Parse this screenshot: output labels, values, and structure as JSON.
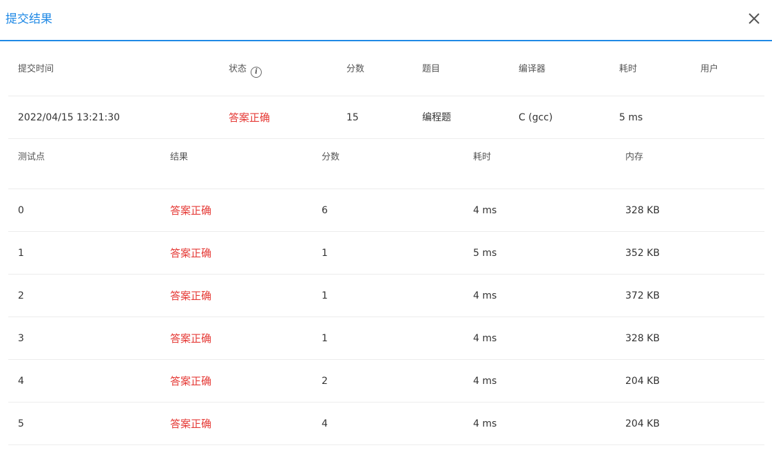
{
  "dialog": {
    "title": "提交结果"
  },
  "summary": {
    "headers": {
      "submit_time": "提交时间",
      "status": "状态",
      "score": "分数",
      "problem": "题目",
      "compiler": "编译器",
      "time": "耗时",
      "user": "用户"
    },
    "row": {
      "submit_time": "2022/04/15 13:21:30",
      "status": "答案正确",
      "score": "15",
      "problem": "编程题",
      "compiler": "C (gcc)",
      "time": "5 ms",
      "user": ""
    }
  },
  "cases": {
    "headers": {
      "case": "测试点",
      "result": "结果",
      "score": "分数",
      "time": "耗时",
      "memory": "内存"
    },
    "rows": [
      {
        "case": "0",
        "result": "答案正确",
        "score": "6",
        "time": "4 ms",
        "memory": "328 KB"
      },
      {
        "case": "1",
        "result": "答案正确",
        "score": "1",
        "time": "5 ms",
        "memory": "352 KB"
      },
      {
        "case": "2",
        "result": "答案正确",
        "score": "1",
        "time": "4 ms",
        "memory": "372 KB"
      },
      {
        "case": "3",
        "result": "答案正确",
        "score": "1",
        "time": "4 ms",
        "memory": "328 KB"
      },
      {
        "case": "4",
        "result": "答案正确",
        "score": "2",
        "time": "4 ms",
        "memory": "204 KB"
      },
      {
        "case": "5",
        "result": "答案正确",
        "score": "4",
        "time": "4 ms",
        "memory": "204 KB"
      }
    ]
  },
  "colors": {
    "accent": "#1e88e5",
    "success_text": "#e53935"
  },
  "icons": {
    "close": "close-icon",
    "info": "info-icon"
  }
}
